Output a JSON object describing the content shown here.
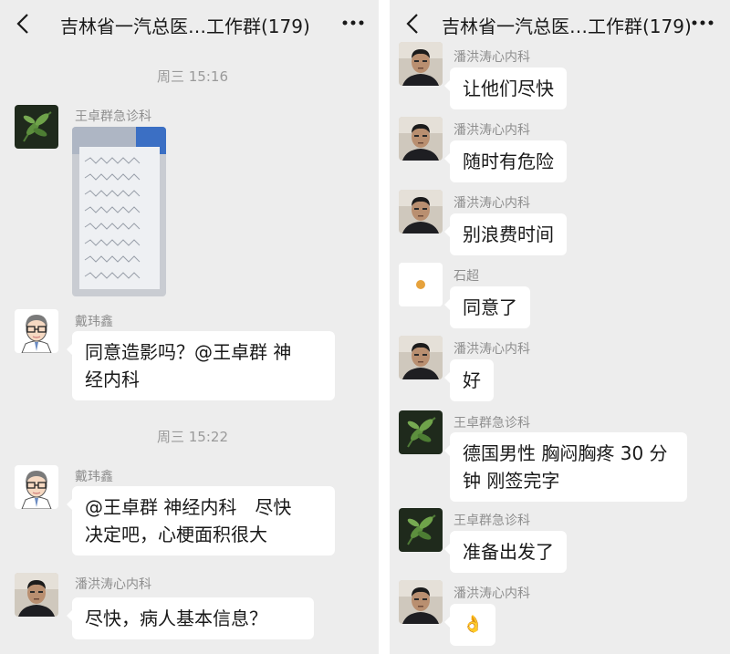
{
  "left": {
    "title": "吉林省一汽总医…工作群(179)",
    "messages": [
      {
        "type": "time",
        "text": "周三 15:16"
      },
      {
        "sender": "王卓群急诊科",
        "avatar": "leaf-avatar",
        "image": "ecg-report-photo"
      },
      {
        "sender": "戴玮鑫",
        "avatar": "doctor-cartoon-avatar",
        "text": "同意造影吗？@王卓群 神\n经内科"
      },
      {
        "type": "time",
        "text": "周三 15:22"
      },
      {
        "sender": "戴玮鑫",
        "avatar": "doctor-cartoon-avatar",
        "text": "@王卓群 神经内科　尽快\n决定吧，心梗面积很大"
      },
      {
        "sender": "潘洪涛心内科",
        "avatar": "man-photo-avatar",
        "text": "尽快，病人基本信息？"
      }
    ]
  },
  "right": {
    "title": "吉林省一汽总医…工作群(179)",
    "messages": [
      {
        "sender": "潘洪涛心内科",
        "avatar": "man-photo-avatar",
        "text": "让他们尽快"
      },
      {
        "sender": "潘洪涛心内科",
        "avatar": "man-photo-avatar",
        "text": "随时有危险"
      },
      {
        "sender": "潘洪涛心内科",
        "avatar": "man-photo-avatar",
        "text": "别浪费时间"
      },
      {
        "sender": "石超",
        "avatar": "orange-dot-avatar",
        "text": "同意了"
      },
      {
        "sender": "潘洪涛心内科",
        "avatar": "man-photo-avatar",
        "text": "好"
      },
      {
        "sender": "王卓群急诊科",
        "avatar": "leaf-avatar",
        "text": "德国男性 胸闷胸疼 30 分\n钟 刚签完字"
      },
      {
        "sender": "王卓群急诊科",
        "avatar": "leaf-avatar",
        "text": "准备出发了"
      },
      {
        "sender": "潘洪涛心内科",
        "avatar": "man-photo-avatar",
        "text": "👌"
      }
    ]
  },
  "colors": {
    "panel_bg": "#ededed",
    "bubble": "#ffffff",
    "text": "#191919",
    "meta": "#9a9a9a"
  }
}
